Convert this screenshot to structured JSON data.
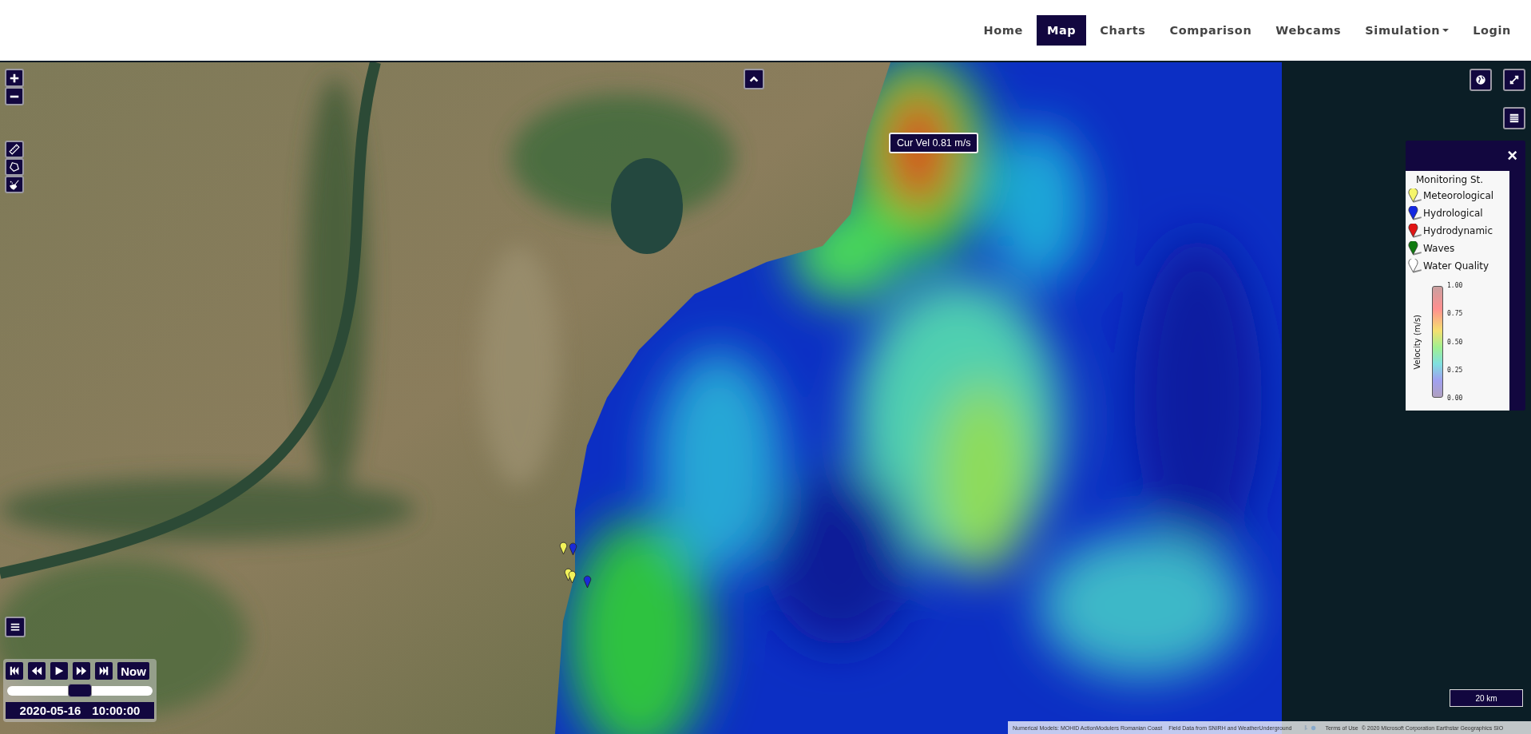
{
  "nav": {
    "items": [
      {
        "label": "Home",
        "selected": false,
        "kind": "link"
      },
      {
        "label": "Map",
        "selected": true,
        "kind": "link"
      },
      {
        "label": "Charts",
        "selected": false,
        "kind": "link"
      },
      {
        "label": "Comparison",
        "selected": false,
        "kind": "link"
      },
      {
        "label": "Webcams",
        "selected": false,
        "kind": "link"
      },
      {
        "label": "Simulation",
        "selected": false,
        "kind": "dropdown"
      },
      {
        "label": "Login",
        "selected": false,
        "kind": "link"
      }
    ]
  },
  "map": {
    "tooltip": "Cur Vel 0.81 m/s",
    "stations": [
      {
        "color": "#f2f25a"
      },
      {
        "color": "#1a2ad8"
      },
      {
        "color": "#f2f25a"
      },
      {
        "color": "#f2f25a"
      },
      {
        "color": "#1a2ad8"
      }
    ],
    "scale": "20 km",
    "attribution": {
      "models": "Numerical Models: MOHID ActionModulers Romanian Coast",
      "field_data": "Field Data from SNIRH and WeatherUnderground",
      "terms": "Terms of Use",
      "copyright": "© 2020 Microsoft Corporation Earthstar Geographics SIO"
    }
  },
  "legend": {
    "close": "×",
    "title": "Monitoring St.",
    "items": [
      {
        "label": "Meteorological",
        "color": "#f5f56a"
      },
      {
        "label": "Hydrological",
        "color": "#1428e0"
      },
      {
        "label": "Hydrodynamic",
        "color": "#e01414"
      },
      {
        "label": "Waves",
        "color": "#107a10"
      },
      {
        "label": "Water Quality",
        "color": "#ffffff"
      }
    ],
    "colorbar": {
      "label": "Velocity (m/s)",
      "ticks": [
        "1.00",
        "0.75",
        "0.50",
        "0.25",
        "0.00"
      ]
    }
  },
  "player": {
    "now": "Now",
    "level": 0.5,
    "date": "2020-05-16",
    "time": "10:00:00"
  }
}
